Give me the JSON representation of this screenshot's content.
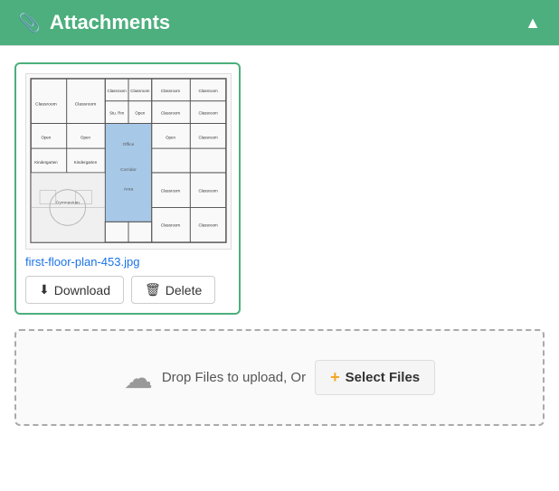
{
  "header": {
    "title": "Attachments",
    "paperclip_icon": "📎",
    "chevron_icon": "▲"
  },
  "attachment": {
    "filename": "first-floor-plan-453.jpg",
    "download_label": "Download",
    "delete_label": "Delete"
  },
  "upload": {
    "drop_text": "Drop Files to upload, Or",
    "select_label": "Select Files",
    "plus_icon": "+"
  }
}
